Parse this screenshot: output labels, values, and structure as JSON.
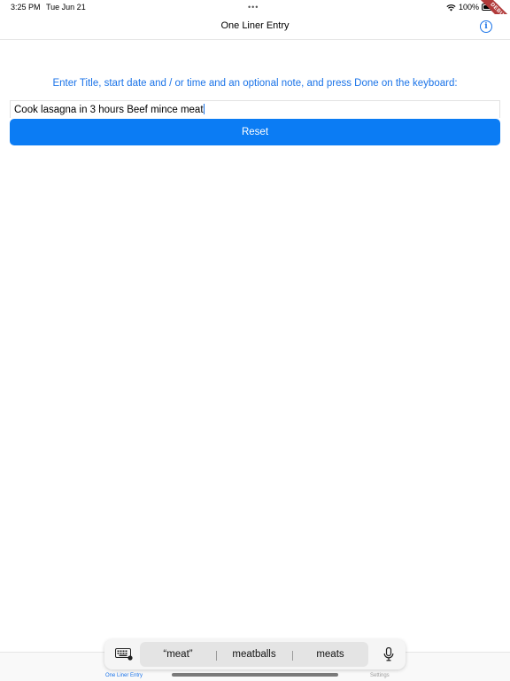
{
  "status_bar": {
    "time": "3:25 PM",
    "date": "Tue Jun 21",
    "dots": "•••",
    "battery": "100%"
  },
  "nav": {
    "title": "One Liner Entry",
    "info_icon": "info-circle-icon"
  },
  "debug_banner": "DEBUG",
  "main": {
    "instructions": "Enter Title, start date and / or time and an optional note, and press Done on the keyboard:",
    "entry_value": "Cook lasagna in 3 hours Beef mince meat",
    "reset_label": "Reset"
  },
  "keyboard": {
    "suggestions": [
      "“meat”",
      "meatballs",
      "meats"
    ],
    "keyboard_icon": "keyboard-icon",
    "mic_icon": "microphone-icon"
  },
  "tab_bar": {
    "tabs": [
      {
        "label": "One Liner Entry",
        "active": true
      },
      {
        "label": "Settings",
        "active": false
      }
    ]
  },
  "colors": {
    "accent": "#1a73e8",
    "button": "#0b7cf4",
    "debug": "#b13a3a"
  }
}
